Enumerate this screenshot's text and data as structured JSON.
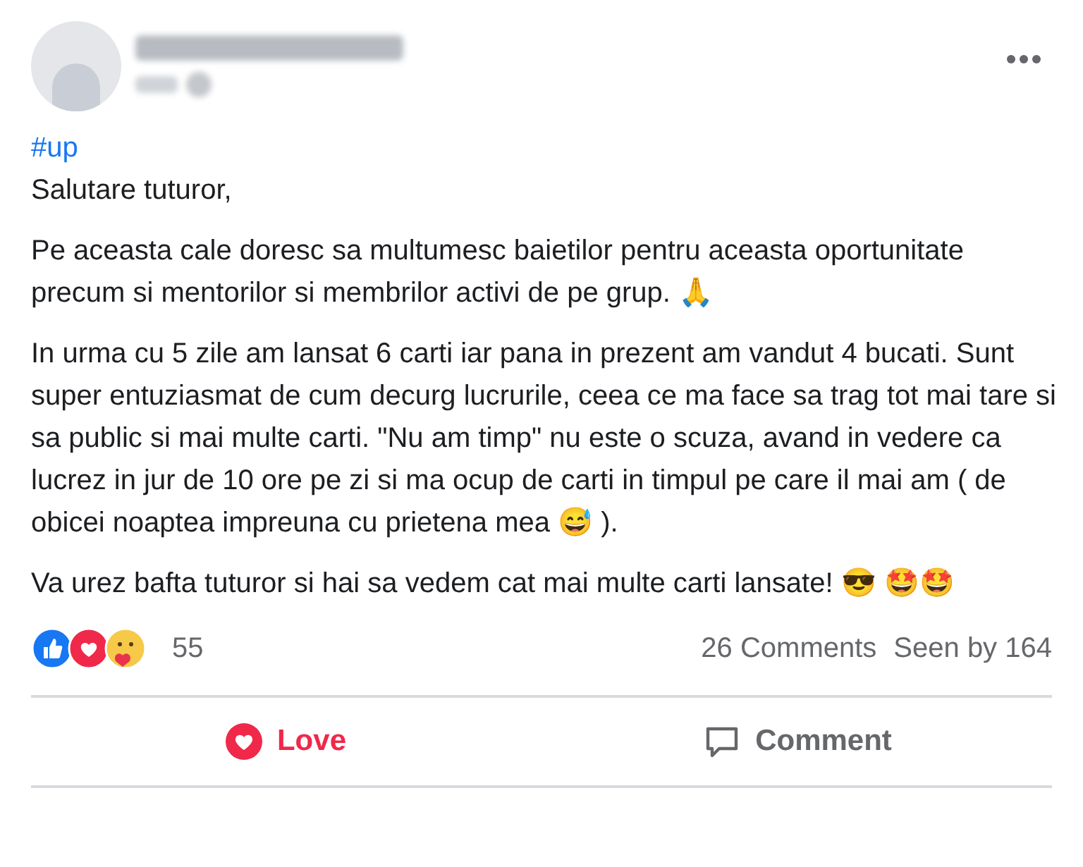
{
  "post": {
    "hashtag": "#up",
    "greeting": "Salutare tuturor,",
    "paragraphs": [
      "Pe aceasta cale doresc sa multumesc baietilor pentru aceasta oportunitate precum si mentorilor si membrilor activi de pe grup. 🙏",
      "In urma cu 5 zile am lansat 6 carti iar pana in prezent am vandut 4 bucati. Sunt super entuziasmat de cum decurg lucrurile, ceea ce ma face sa trag tot mai tare si sa public si mai multe carti. \"Nu am timp\" nu este o scuza, avand in vedere ca lucrez in jur de 10 ore pe zi si ma ocup de carti in timpul pe care il mai am ( de obicei noaptea impreuna cu prietena mea 😅 ).",
      "Va urez bafta tuturor si hai sa vedem cat mai multe carti lansate! 😎 🤩🤩"
    ]
  },
  "reactions": {
    "count": "55",
    "comments": "26 Comments",
    "seen": "Seen by 164"
  },
  "actions": [
    {
      "kind": "love",
      "label": "Love",
      "selected": true
    },
    {
      "kind": "comment",
      "label": "Comment",
      "selected": false
    }
  ]
}
